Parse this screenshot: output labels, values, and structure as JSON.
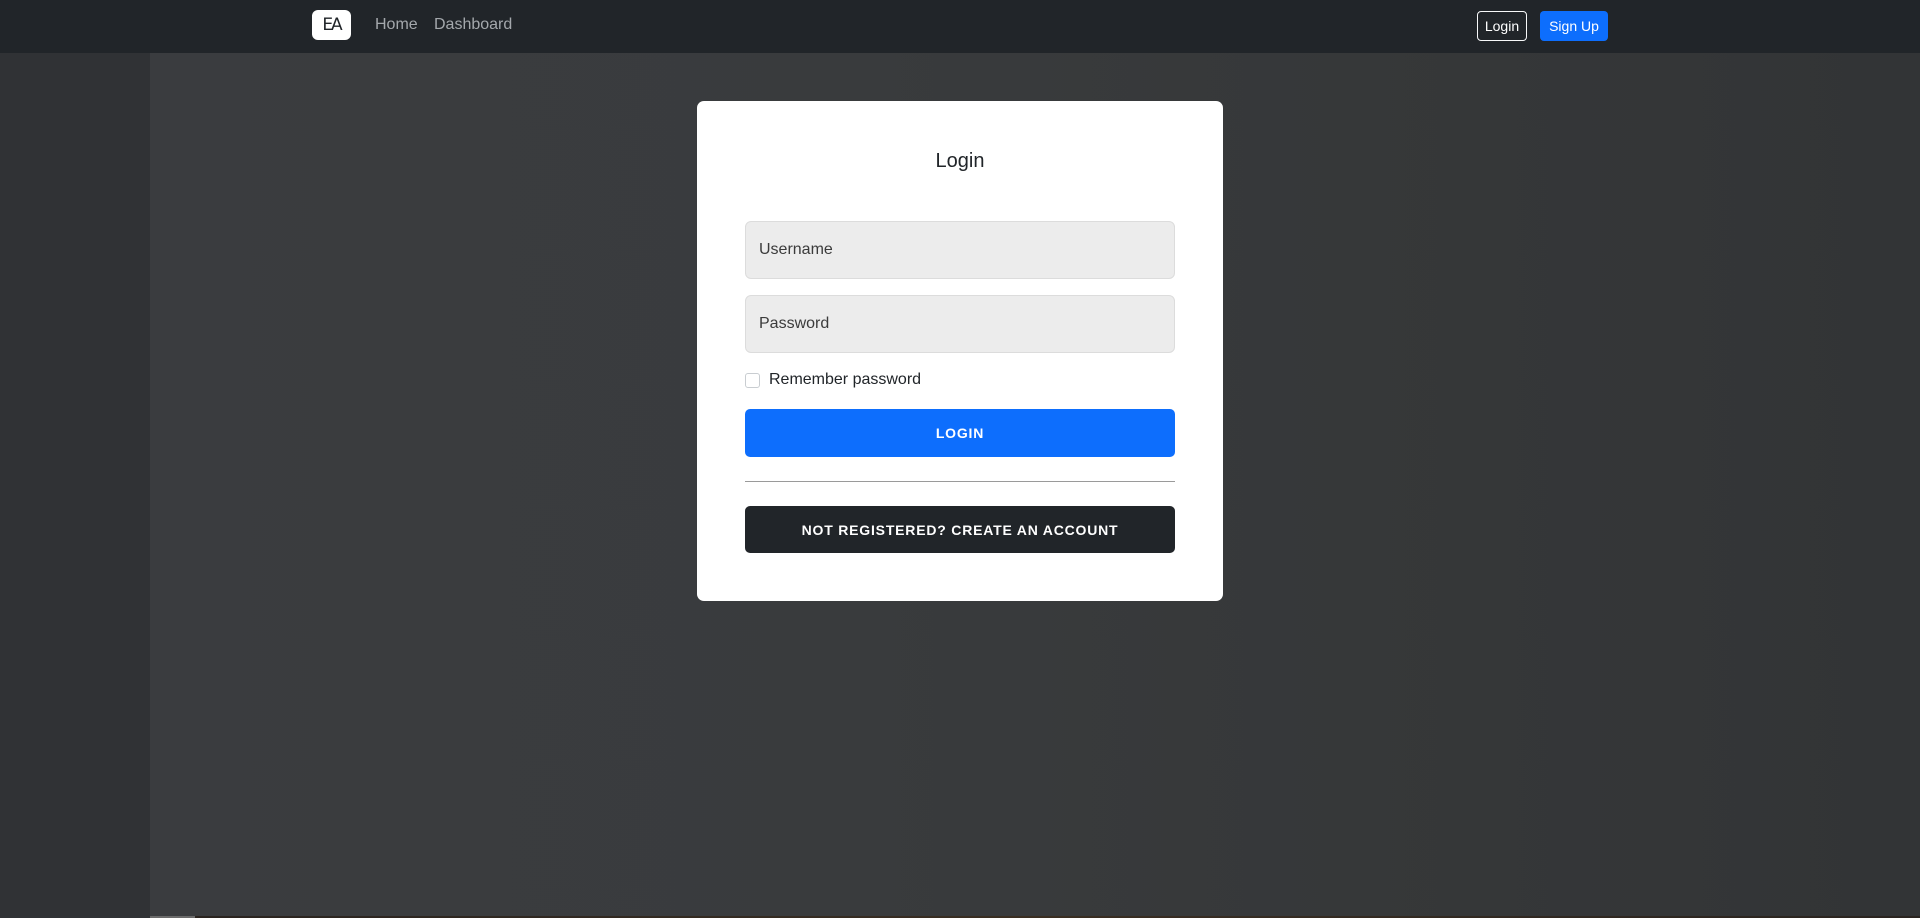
{
  "navbar": {
    "brand_text": "EA",
    "links": [
      {
        "label": "Home"
      },
      {
        "label": "Dashboard"
      }
    ],
    "login_label": "Login",
    "signup_label": "Sign Up"
  },
  "colors": {
    "navbar_bg": "#212529",
    "primary": "#0d6efd",
    "dark_button": "#212529",
    "card_bg": "#ffffff"
  },
  "login_card": {
    "title": "Login",
    "username_placeholder": "Username",
    "password_placeholder": "Password",
    "remember_label": "Remember password",
    "remember_checked": false,
    "login_button": "LOGIN",
    "create_account_button": "NOT REGISTERED? CREATE AN ACCOUNT"
  }
}
